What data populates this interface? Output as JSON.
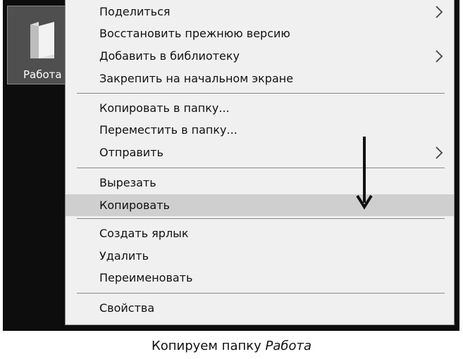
{
  "desktop": {
    "folder_label": "Работа"
  },
  "context_menu": {
    "items": [
      {
        "label": "Поделиться",
        "submenu": true
      },
      {
        "label": "Восстановить прежнюю версию",
        "submenu": false
      },
      {
        "label": "Добавить в библиотеку",
        "submenu": true
      },
      {
        "label": "Закрепить на начальном экране",
        "submenu": false
      },
      {
        "label": "Копировать в папку...",
        "submenu": false
      },
      {
        "label": "Переместить в папку...",
        "submenu": false
      },
      {
        "label": "Отправить",
        "submenu": true
      },
      {
        "label": "Вырезать",
        "submenu": false
      },
      {
        "label": "Копировать",
        "submenu": false,
        "highlighted": true
      },
      {
        "label": "Создать ярлык",
        "submenu": false
      },
      {
        "label": "Удалить",
        "submenu": false
      },
      {
        "label": "Переименовать",
        "submenu": false
      },
      {
        "label": "Свойства",
        "submenu": false
      }
    ]
  },
  "caption": {
    "text": "Копируем папку ",
    "emphasis": "Работа"
  },
  "colors": {
    "desktop_bg": "#0d0d0d",
    "menu_bg": "#f0f0f0",
    "highlight_bg": "#cfcfcf",
    "separator": "#8a8a8a"
  },
  "icons": {
    "folder": "folder-icon",
    "submenu": "chevron-right-icon",
    "pointer": "down-arrow-icon"
  }
}
